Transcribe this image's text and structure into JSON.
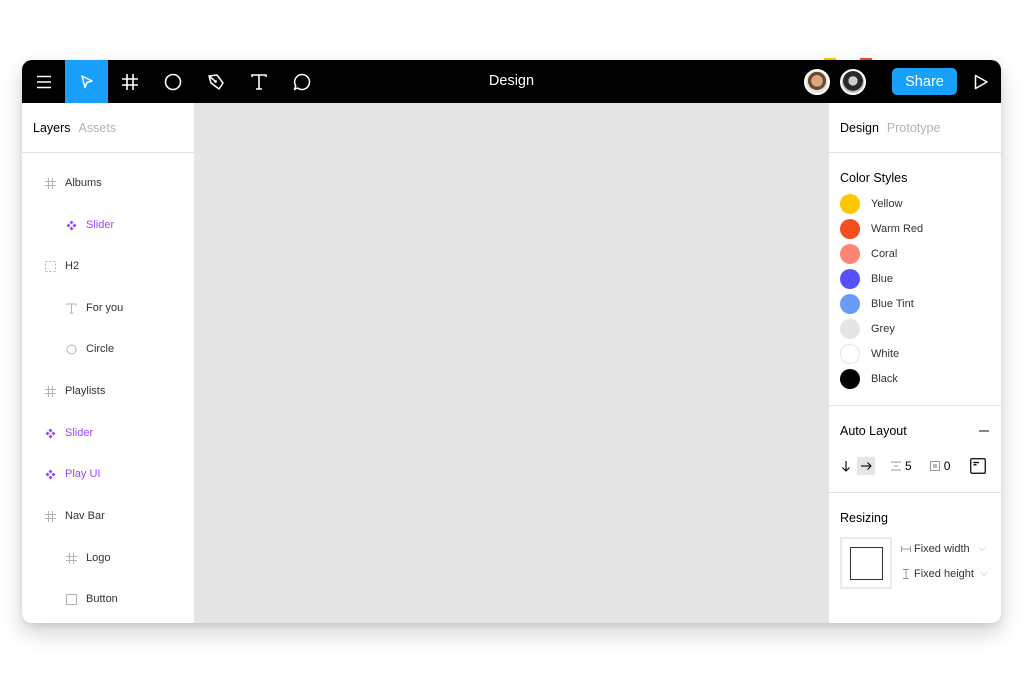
{
  "presence": {
    "colors": [
      "#ffc700",
      "#f24e1e"
    ]
  },
  "toolbar": {
    "tools": [
      {
        "name": "menu",
        "icon": "hamburger-menu-icon"
      },
      {
        "name": "move",
        "icon": "cursor-arrow-icon",
        "active": true
      },
      {
        "name": "frame",
        "icon": "frame-hash-icon"
      },
      {
        "name": "ellipse",
        "icon": "circle-icon"
      },
      {
        "name": "pen",
        "icon": "pen-icon"
      },
      {
        "name": "text",
        "icon": "text-t-icon"
      },
      {
        "name": "comment",
        "icon": "comment-bubble-icon"
      }
    ],
    "title": "Design",
    "share_label": "Share",
    "accent": "#18a0fb"
  },
  "left_panel": {
    "tabs": [
      {
        "label": "Layers",
        "active": true
      },
      {
        "label": "Assets",
        "active": false
      }
    ],
    "layers": [
      {
        "label": "Albums",
        "icon": "frame-icon",
        "indent": 0,
        "type": "frame"
      },
      {
        "label": "Slider",
        "icon": "component-icon",
        "indent": 1,
        "type": "component"
      },
      {
        "label": "H2",
        "icon": "group-dashed-icon",
        "indent": 0,
        "type": "group"
      },
      {
        "label": "For you",
        "icon": "text-icon",
        "indent": 1,
        "type": "text"
      },
      {
        "label": "Circle",
        "icon": "ellipse-icon",
        "indent": 1,
        "type": "ellipse"
      },
      {
        "label": "Playlists",
        "icon": "frame-icon",
        "indent": 0,
        "type": "frame"
      },
      {
        "label": "Slider",
        "icon": "component-icon",
        "indent": 0,
        "type": "component"
      },
      {
        "label": "Play UI",
        "icon": "component-icon",
        "indent": 0,
        "type": "component"
      },
      {
        "label": "Nav Bar",
        "icon": "frame-icon",
        "indent": 0,
        "type": "frame"
      },
      {
        "label": "Logo",
        "icon": "frame-icon",
        "indent": 1,
        "type": "frame"
      },
      {
        "label": "Button",
        "icon": "rectangle-icon",
        "indent": 1,
        "type": "rectangle"
      }
    ]
  },
  "right_panel": {
    "tabs": [
      {
        "label": "Design",
        "active": true
      },
      {
        "label": "Prototype",
        "active": false
      }
    ],
    "color_styles": {
      "title": "Color Styles",
      "items": [
        {
          "name": "Yellow",
          "color": "#ffc700"
        },
        {
          "name": "Warm Red",
          "color": "#f24e1e"
        },
        {
          "name": "Coral",
          "color": "#ff8577"
        },
        {
          "name": "Blue",
          "color": "#5551ff"
        },
        {
          "name": "Blue Tint",
          "color": "#699bf7"
        },
        {
          "name": "Grey",
          "color": "#e5e5e5"
        },
        {
          "name": "White",
          "color": "#ffffff"
        },
        {
          "name": "Black",
          "color": "#000000"
        }
      ]
    },
    "auto_layout": {
      "title": "Auto Layout",
      "spacing": "5",
      "padding": "0"
    },
    "resizing": {
      "title": "Resizing",
      "width_mode": "Fixed width",
      "height_mode": "Fixed height"
    }
  }
}
